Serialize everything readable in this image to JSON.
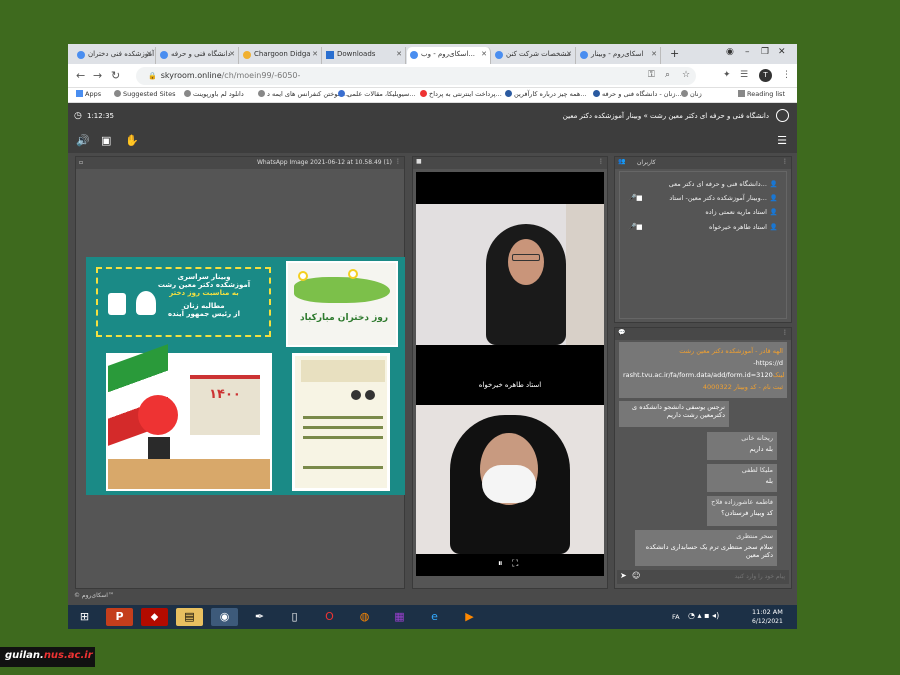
{
  "browser": {
    "tabs": [
      {
        "label": "آموزشکده فنی دختران"
      },
      {
        "label": "دانشگاه فنی و حرفه"
      },
      {
        "label": "Chargoon Didga"
      },
      {
        "label": "Downloads"
      },
      {
        "label": "اسکای‌روم - وب..."
      },
      {
        "label": "مشخصات شرکت کنن"
      },
      {
        "label": "اسکای‌روم - وبینار"
      }
    ],
    "new_tab": "+",
    "url_host": "skyroom.online",
    "url_path": "/ch/moein99/-6050-",
    "avatar_letter": "T",
    "bookmarks": [
      {
        "label": "Apps"
      },
      {
        "label": "Suggested Sites"
      },
      {
        "label": "دانلود لم باورپوینت"
      },
      {
        "label": "سوختن کنفرانس های ایمه د..."
      },
      {
        "label": "سیویلیکا، مقالات علمی..."
      },
      {
        "label": "پرداخت اینترنتی به پرداخ..."
      },
      {
        "label": "همه چیز درباره کارآفرین..."
      },
      {
        "label": "زنان - دانشگاه فنی و حرفه..."
      },
      {
        "label": "زنان"
      }
    ],
    "reading_list": "Reading list"
  },
  "app": {
    "timer": "1:12:35",
    "title": "دانشگاه فنی و حرفه ای دکتر معین رشت » وبینار آموزشکده دکتر معین",
    "presentation": {
      "file_title": "WhatsApp Image 2021-06-12 at 10.58.49 (1)",
      "slide": {
        "heading_line1": "وبینار سراسری",
        "heading_line2": "آموزشکده دکتر معین رشت",
        "heading_line3": "به مناسبت روز دختر",
        "subtitle_line1": "مطالبه زنان",
        "subtitle_line2": "از رئیس جمهور آینده",
        "banner_text": "روز دختران مبارکباد",
        "calendar_text": "۱۴۰۰"
      }
    },
    "video": {
      "speaker1_name": "استاد طاهره خیرخواه"
    },
    "users": {
      "header": "کاربران",
      "list": [
        {
          "name": "دانشگاه فنی و حرفه ای دکتر معی..."
        },
        {
          "name": "وبینار آموزشکده دکتر معین- استاد..."
        },
        {
          "name": "استاد ماریه نعمتی زاده"
        },
        {
          "name": "استاد طاهره خیرخواه"
        }
      ]
    },
    "chat": {
      "pinned_line1": "الهه قادر - آموزشکده دکتر معین رشت",
      "pinned_line2": "https://d-",
      "pinned_line3": "rasht.tvu.ac.ir/fa/form.data/add/form.id=3120",
      "pinned_line4": "ثبت نام - کد وبینار 4000322",
      "pinned_link_word": "لینک",
      "messages": [
        {
          "author": "",
          "text": "نرجس یوسفی دانشجو دانشکده ی دکترمعین رشت داریم"
        },
        {
          "author": "ریحانه خانی",
          "text": "بله داریم"
        },
        {
          "author": "ملیکا لطفی",
          "text": "بله"
        },
        {
          "author": "فاطمه عاشورزاده فلاح",
          "text": "کد وبینار فرستادن؟"
        },
        {
          "author": "سحر منتظری",
          "text": "سلام سحر منتظری ترم یک حسابداری دانشکده دکتر معین"
        }
      ],
      "input_placeholder": "پیام خود را وارد کنید"
    },
    "footer_brand": "© اسکای‌روم™"
  },
  "taskbar": {
    "lang": "FA",
    "time": "11:02 AM",
    "date": "6/12/2021"
  },
  "watermark": {
    "prefix": "guilan.",
    "highlight": "nus.ac.ir"
  },
  "colors": {
    "background": "#3e6a1e",
    "app_bg": "#4a4a4a",
    "accent_blue": "#4a90e2",
    "chat_orange": "#f0a030"
  }
}
